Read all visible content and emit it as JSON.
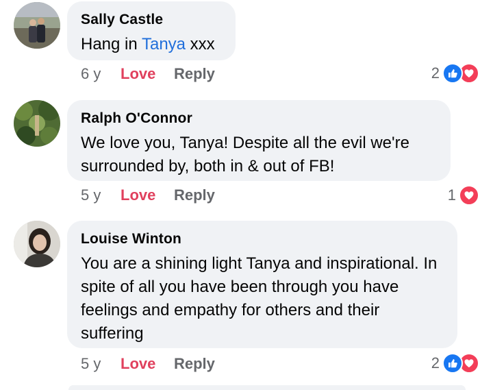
{
  "comments": [
    {
      "author": "Sally Castle",
      "text_before": "Hang in ",
      "mention": "Tanya",
      "text_after": " xxx",
      "age": "6 y",
      "love_label": "Love",
      "reply_label": "Reply",
      "reaction_count": "2",
      "reaction_icons": [
        "like-icon",
        "love-icon"
      ]
    },
    {
      "author": "Ralph O'Connor",
      "text": "We love you, Tanya!  Despite all the evil we're surrounded by, both in & out of FB!",
      "age": "5 y",
      "love_label": "Love",
      "reply_label": "Reply",
      "reaction_count": "1",
      "reaction_icons": [
        "love-icon"
      ]
    },
    {
      "author": "Louise Winton",
      "text": "You are a shining light Tanya and inspirational. In spite of all you have been through you have feelings and empathy for others and their suffering",
      "age": "5 y",
      "love_label": "Love",
      "reply_label": "Reply",
      "reaction_count": "2",
      "reaction_icons": [
        "like-icon",
        "love-icon"
      ]
    }
  ],
  "colors": {
    "bubble": "#f0f2f5",
    "mention": "#216fdb",
    "love_action": "#e0405d",
    "like_reaction": "#1877f2",
    "love_reaction": "#f33e58",
    "secondary_text": "#65676b"
  }
}
